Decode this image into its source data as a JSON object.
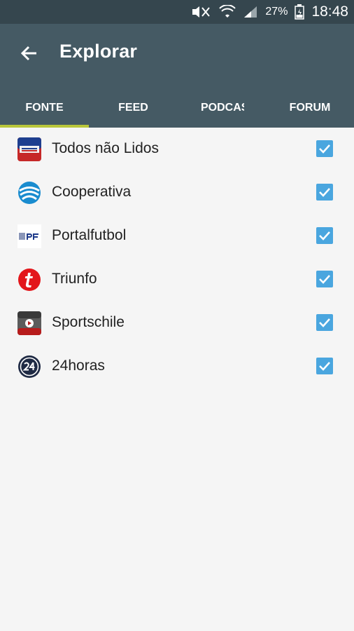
{
  "status": {
    "battery_pct": "27%",
    "time": "18:48"
  },
  "header": {
    "title": "Explorar"
  },
  "tabs": [
    {
      "label": "FONTE"
    },
    {
      "label": "FEED"
    },
    {
      "label": "PODCASTS"
    },
    {
      "label": "FORUM"
    }
  ],
  "sources": [
    {
      "label": "Todos não Lidos",
      "checked": true
    },
    {
      "label": "Cooperativa",
      "checked": true
    },
    {
      "label": "Portalfutbol",
      "checked": true
    },
    {
      "label": "Triunfo",
      "checked": true
    },
    {
      "label": "Sportschile",
      "checked": true
    },
    {
      "label": "24horas",
      "checked": true
    }
  ],
  "colors": {
    "status_bg": "#35464e",
    "appbar_bg": "#455a64",
    "tab_indicator": "#b9c63a",
    "checkbox": "#4aa6df"
  }
}
